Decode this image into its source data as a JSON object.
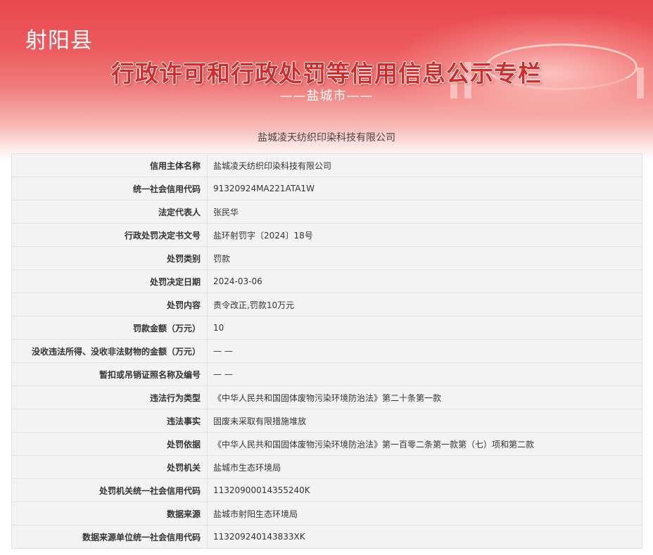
{
  "header": {
    "county": "射阳县",
    "title": "行政许可和行政处罚等信用信息公示专栏",
    "city": "——盐城市——"
  },
  "company_heading": "盐城凌天纺织印染科技有限公司",
  "rows": [
    {
      "label": "信用主体名称",
      "value": "盐城凌天纺织印染科技有限公司"
    },
    {
      "label": "统一社会信用代码",
      "value": "91320924MA221ATA1W"
    },
    {
      "label": "法定代表人",
      "value": "张民华"
    },
    {
      "label": "行政处罚决定书文号",
      "value": "盐环射罚字〔2024〕18号"
    },
    {
      "label": "处罚类别",
      "value": "罚款"
    },
    {
      "label": "处罚决定日期",
      "value": "2024-03-06"
    },
    {
      "label": "处罚内容",
      "value": "责令改正,罚款10万元"
    },
    {
      "label": "罚款金额（万元）",
      "value": "10"
    },
    {
      "label": "没收违法所得、没收非法财物的金额（万元）",
      "value": "— —"
    },
    {
      "label": "暂扣或吊销证照名称及编号",
      "value": "— —"
    },
    {
      "label": "违法行为类型",
      "value": "《中华人民共和国固体废物污染环境防治法》第二十条第一款"
    },
    {
      "label": "违法事实",
      "value": "固废未采取有限措施堆放"
    },
    {
      "label": "处罚依据",
      "value": "《中华人民共和国固体废物污染环境防治法》第一百零二条第一款第（七）项和第二款"
    },
    {
      "label": "处罚机关",
      "value": "盐城市生态环境局"
    },
    {
      "label": "处罚机关统一社会信用代码",
      "value": "11320900014355240K"
    },
    {
      "label": "数据来源",
      "value": "盐城市射阳生态环境局"
    },
    {
      "label": "数据来源单位统一社会信用代码",
      "value": "113209240143833XK"
    }
  ],
  "colors": {
    "banner_red": "#e8474d",
    "title_red": "#d42a2a",
    "row_bg": "#f3f3f3",
    "border": "#e3e3e3"
  }
}
